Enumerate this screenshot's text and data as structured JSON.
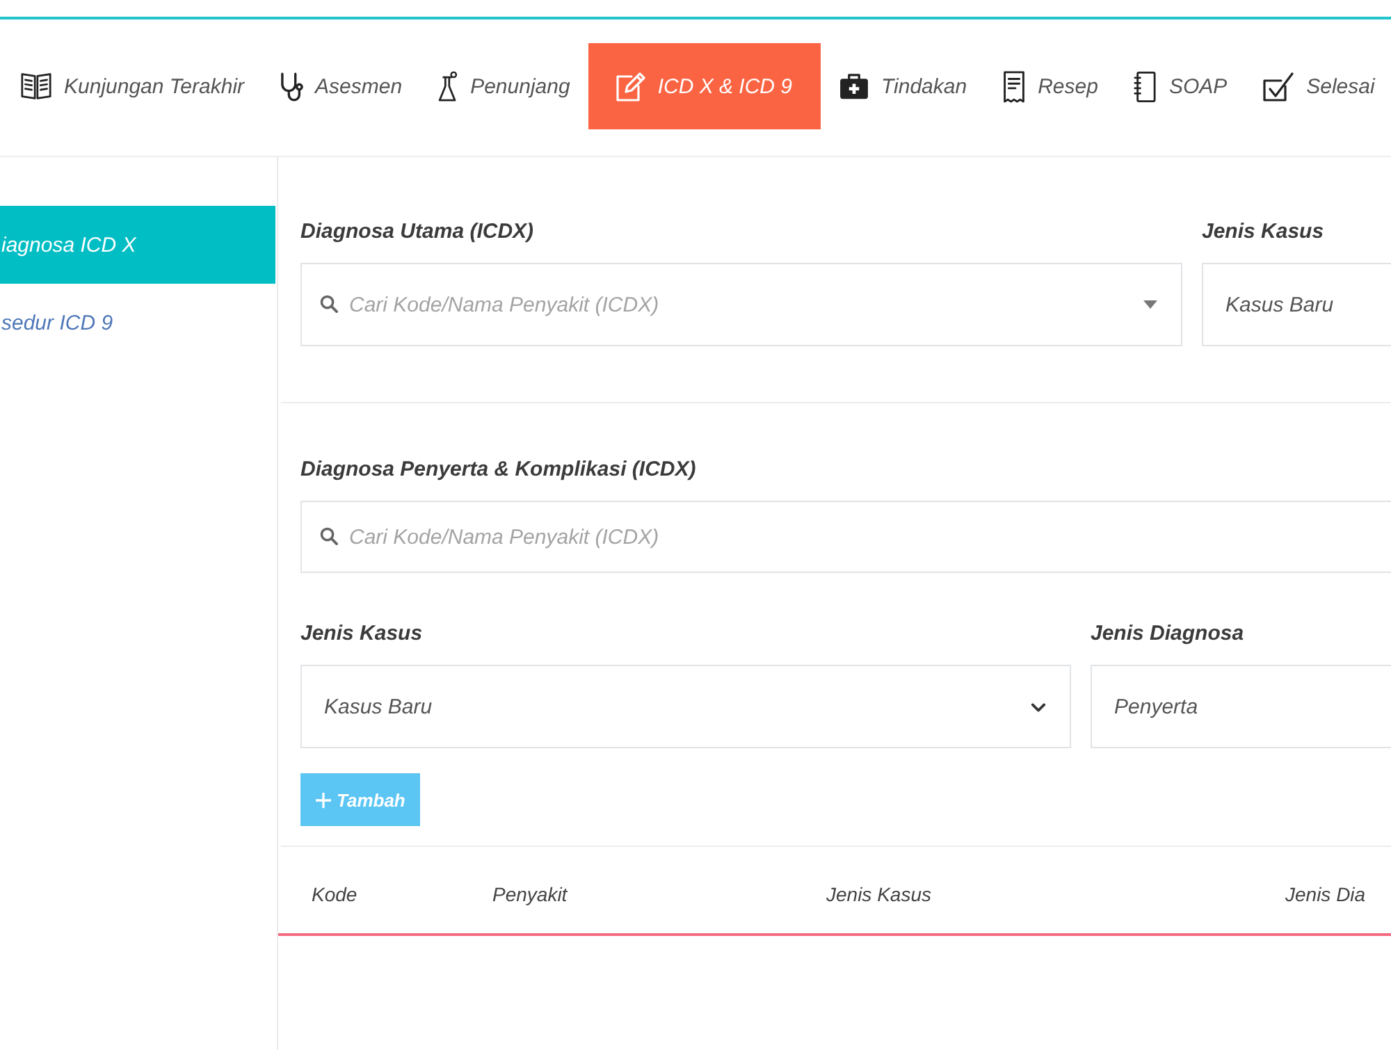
{
  "top_nav": {
    "tabs": [
      {
        "label": "Kunjungan Terakhir",
        "selected": false
      },
      {
        "label": "Asesmen",
        "selected": false
      },
      {
        "label": "Penunjang",
        "selected": false
      },
      {
        "label": "ICD X & ICD 9",
        "selected": true
      },
      {
        "label": "Tindakan",
        "selected": false
      },
      {
        "label": "Resep",
        "selected": false
      },
      {
        "label": "SOAP",
        "selected": false
      },
      {
        "label": "Selesai",
        "selected": false
      }
    ]
  },
  "sidebar": {
    "items": [
      {
        "label": "iagnosa ICD X",
        "selected": true
      },
      {
        "label": "sedur ICD 9",
        "selected": false
      }
    ]
  },
  "main_diagnosis": {
    "label": "Diagnosa Utama (ICDX)",
    "placeholder": "Cari Kode/Nama Penyakit (ICDX)"
  },
  "main_case_type": {
    "label": "Jenis Kasus",
    "value": "Kasus Baru"
  },
  "secondary_diagnosis": {
    "label": "Diagnosa Penyerta & Komplikasi (ICDX)",
    "placeholder": "Cari Kode/Nama Penyakit (ICDX)"
  },
  "secondary_case_type": {
    "label": "Jenis Kasus",
    "value": "Kasus Baru"
  },
  "diagnosis_type": {
    "label": "Jenis Diagnosa",
    "value": "Penyerta"
  },
  "add_button": {
    "label": "Tambah"
  },
  "table": {
    "columns": [
      "Kode",
      "Penyakit",
      "Jenis Kasus",
      "Jenis Dia"
    ]
  }
}
